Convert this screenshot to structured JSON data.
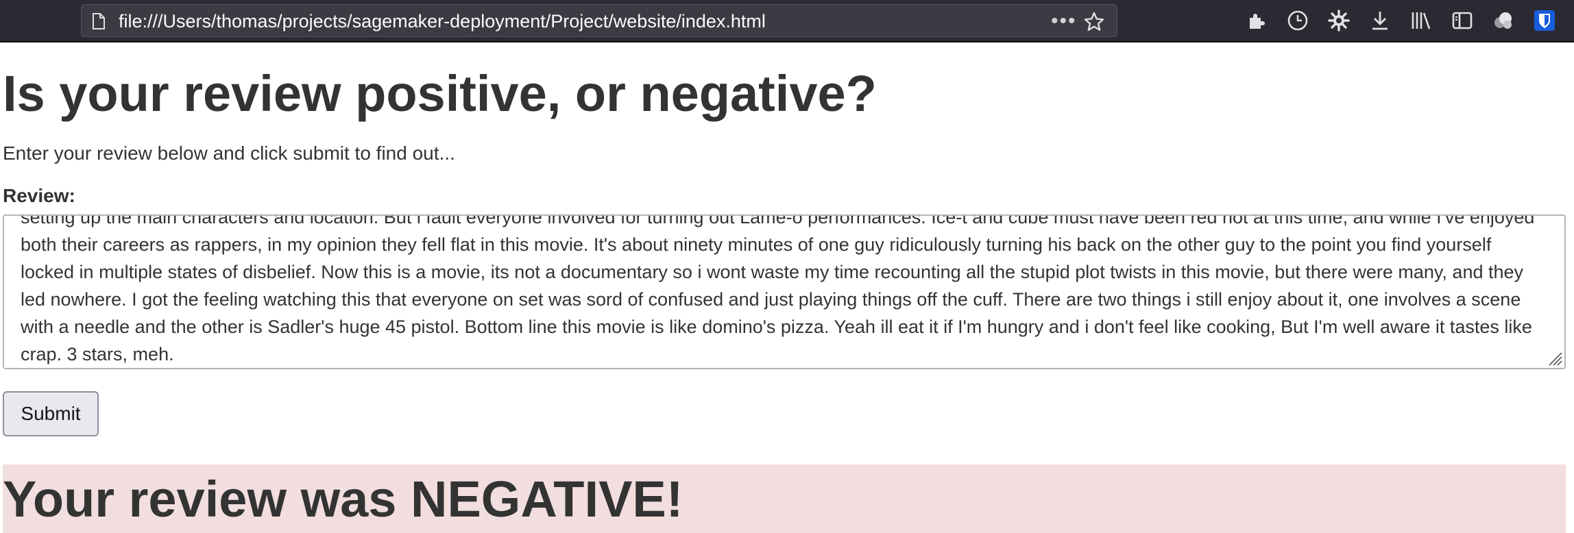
{
  "browser": {
    "url": "file:///Users/thomas/projects/sagemaker-deployment/Project/website/index.html",
    "more_label": "•••",
    "toolbar_icons": [
      "extensions-icon",
      "history-icon",
      "settings-icon",
      "downloads-icon",
      "library-icon",
      "sidebar-icon",
      "account-icon",
      "bitwarden-icon"
    ]
  },
  "page": {
    "title": "Is your review positive, or negative?",
    "lead": "Enter your review below and click submit to find out...",
    "review_label": "Review:",
    "review_text": "setting up the main characters and location. But i fault everyone involved for turning out Lame-o performances. Ice-t and cube must have been red hot at this time, and while I've enjoyed both their careers as rappers, in my opinion they fell flat in this movie. It's about ninety minutes of one guy ridiculously turning his back on the other guy to the point you find yourself locked in multiple states of disbelief. Now this is a movie, its not a documentary so i wont waste my time recounting all the stupid plot twists in this movie, but there were many, and they led nowhere. I got the feeling watching this that everyone on set was sord of confused and just playing things off the cuff. There are two things i still enjoy about it, one involves a scene with a needle and the other is Sadler's huge 45 pistol. Bottom line this movie is like domino's pizza. Yeah ill eat it if I'm hungry and i don't feel like cooking, But I'm well aware it tastes like crap. 3 stars, meh.",
    "submit_label": "Submit",
    "result_text": "Your review was NEGATIVE!"
  },
  "colors": {
    "toolbar_bg": "#2b2a33",
    "result_bg": "#f2dede",
    "text": "#333333",
    "bitwarden_blue": "#175ddc"
  }
}
